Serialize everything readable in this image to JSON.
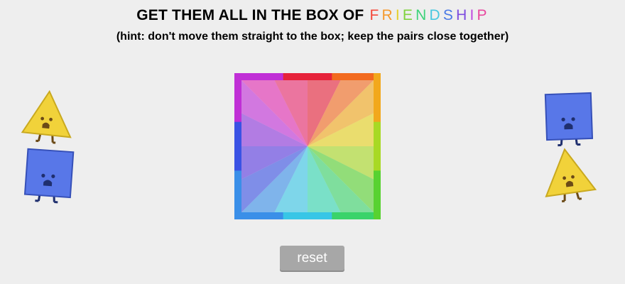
{
  "title": {
    "prefix": "GET THEM ALL IN THE BOX OF ",
    "word_letters": [
      {
        "char": "F",
        "color": "#f4483a"
      },
      {
        "char": "R",
        "color": "#f59a2e"
      },
      {
        "char": "I",
        "color": "#e4cf2b"
      },
      {
        "char": "E",
        "color": "#7fd23d"
      },
      {
        "char": "N",
        "color": "#3fd37a"
      },
      {
        "char": "D",
        "color": "#48c8e0"
      },
      {
        "char": "S",
        "color": "#4a79e6"
      },
      {
        "char": "H",
        "color": "#7d4be0"
      },
      {
        "char": "I",
        "color": "#c047de"
      },
      {
        "char": "P",
        "color": "#e8479e"
      }
    ]
  },
  "hint": "(hint: don't move them straight to the box; keep the pairs close together)",
  "box": {
    "wedge_colors": [
      "#e6223a",
      "#f26a1f",
      "#f2a81c",
      "#e6d21e",
      "#a8d924",
      "#58d231",
      "#3ad36a",
      "#32d6b0",
      "#38c6e6",
      "#3a8fe8",
      "#3a52e4",
      "#5a3ae0",
      "#8d36dc",
      "#c02fd6",
      "#e02cb0",
      "#e82a6e"
    ],
    "frame_colors": {
      "top": [
        "#c02fd6",
        "#e6223a",
        "#f26a1f"
      ],
      "right": [
        "#f2a81c",
        "#a8d924",
        "#58d231"
      ],
      "bottom": [
        "#3a8fe8",
        "#38c6e6",
        "#3ad36a"
      ],
      "left": [
        "#c02fd6",
        "#3a52e4",
        "#3a8fe8"
      ]
    }
  },
  "creatures": {
    "triangle_fill": "#f1d23a",
    "triangle_stroke": "#c9a91f",
    "square_fill": "#5877e8",
    "square_stroke": "#3650b8",
    "face_color": "#6b4a17",
    "square_face_color": "#1f2f6e"
  },
  "reset_label": "reset"
}
